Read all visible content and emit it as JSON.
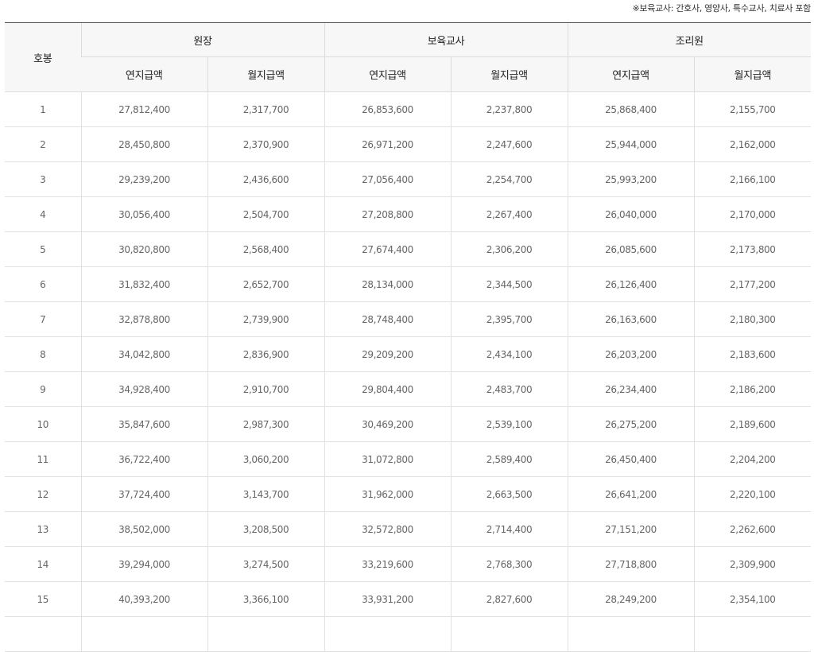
{
  "note": "※보육교사: 간호사, 영양사, 특수교사, 치료사 포함",
  "header": {
    "grade": "호봉",
    "groups": [
      "원장",
      "보육교사",
      "조리원"
    ],
    "annual": "연지급액",
    "monthly": "월지급액"
  },
  "rows": [
    [
      "1",
      "27,812,400",
      "2,317,700",
      "26,853,600",
      "2,237,800",
      "25,868,400",
      "2,155,700"
    ],
    [
      "2",
      "28,450,800",
      "2,370,900",
      "26,971,200",
      "2,247,600",
      "25,944,000",
      "2,162,000"
    ],
    [
      "3",
      "29,239,200",
      "2,436,600",
      "27,056,400",
      "2,254,700",
      "25,993,200",
      "2,166,100"
    ],
    [
      "4",
      "30,056,400",
      "2,504,700",
      "27,208,800",
      "2,267,400",
      "26,040,000",
      "2,170,000"
    ],
    [
      "5",
      "30,820,800",
      "2,568,400",
      "27,674,400",
      "2,306,200",
      "26,085,600",
      "2,173,800"
    ],
    [
      "6",
      "31,832,400",
      "2,652,700",
      "28,134,000",
      "2,344,500",
      "26,126,400",
      "2,177,200"
    ],
    [
      "7",
      "32,878,800",
      "2,739,900",
      "28,748,400",
      "2,395,700",
      "26,163,600",
      "2,180,300"
    ],
    [
      "8",
      "34,042,800",
      "2,836,900",
      "29,209,200",
      "2,434,100",
      "26,203,200",
      "2,183,600"
    ],
    [
      "9",
      "34,928,400",
      "2,910,700",
      "29,804,400",
      "2,483,700",
      "26,234,400",
      "2,186,200"
    ],
    [
      "10",
      "35,847,600",
      "2,987,300",
      "30,469,200",
      "2,539,100",
      "26,275,200",
      "2,189,600"
    ],
    [
      "11",
      "36,722,400",
      "3,060,200",
      "31,072,800",
      "2,589,400",
      "26,450,400",
      "2,204,200"
    ],
    [
      "12",
      "37,724,400",
      "3,143,700",
      "31,962,000",
      "2,663,500",
      "26,641,200",
      "2,220,100"
    ],
    [
      "13",
      "38,502,000",
      "3,208,500",
      "32,572,800",
      "2,714,400",
      "27,151,200",
      "2,262,600"
    ],
    [
      "14",
      "39,294,000",
      "3,274,500",
      "33,219,600",
      "2,768,300",
      "27,718,800",
      "2,309,900"
    ],
    [
      "15",
      "40,393,200",
      "3,366,100",
      "33,931,200",
      "2,827,600",
      "28,249,200",
      "2,354,100"
    ],
    [
      "",
      "",
      "",
      "",
      "",
      "",
      ""
    ]
  ]
}
